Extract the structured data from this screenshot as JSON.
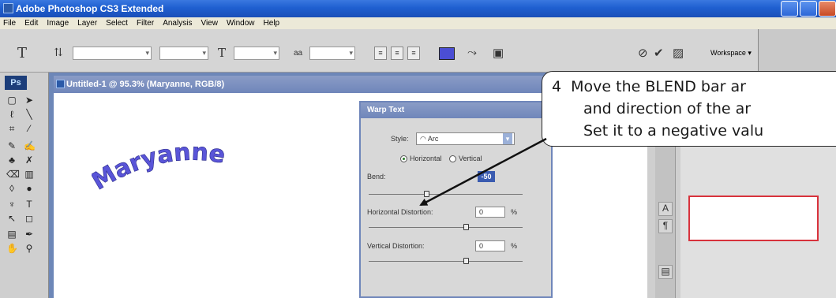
{
  "app": {
    "title": "Adobe Photoshop CS3 Extended",
    "menu": [
      "File",
      "Edit",
      "Image",
      "Layer",
      "Select",
      "Filter",
      "Analysis",
      "View",
      "Window",
      "Help"
    ]
  },
  "options_bar": {
    "workspace_label": "Workspace ▾",
    "swatch_color": "#4b4ed4",
    "icons": [
      "type-tool-icon",
      "orientation-icon",
      "font-size-icon",
      "antialias-icon",
      "align-left-icon",
      "align-center-icon",
      "align-right-icon",
      "warp-text-icon",
      "palettes-icon",
      "cancel-icon",
      "commit-icon"
    ]
  },
  "tools_panel": {
    "logo": "Ps"
  },
  "document": {
    "title": "Untitled-1 @ 95.3% (Maryanne, RGB/8)",
    "warped_text": "Maryanne",
    "text_color": "#5a55d8"
  },
  "warp_dialog": {
    "title": "Warp Text",
    "style_label": "Style:",
    "style_value": "Arc",
    "horizontal_label": "Horizontal",
    "vertical_label": "Vertical",
    "bend_label": "Bend:",
    "bend_value": "-50",
    "h_distortion_label": "Horizontal Distortion:",
    "h_distortion_value": "0",
    "v_distortion_label": "Vertical Distortion:",
    "v_distortion_value": "0",
    "percent": "%"
  },
  "callout": {
    "line1": "4  Move the BLEND bar ar",
    "line2": "and direction of the ar",
    "line3": "Set it to a negative valu"
  },
  "colors": {
    "titlebar": "#1f5fd0",
    "callout_border": "#2a2a2a",
    "panel_red": "#d8323c"
  }
}
